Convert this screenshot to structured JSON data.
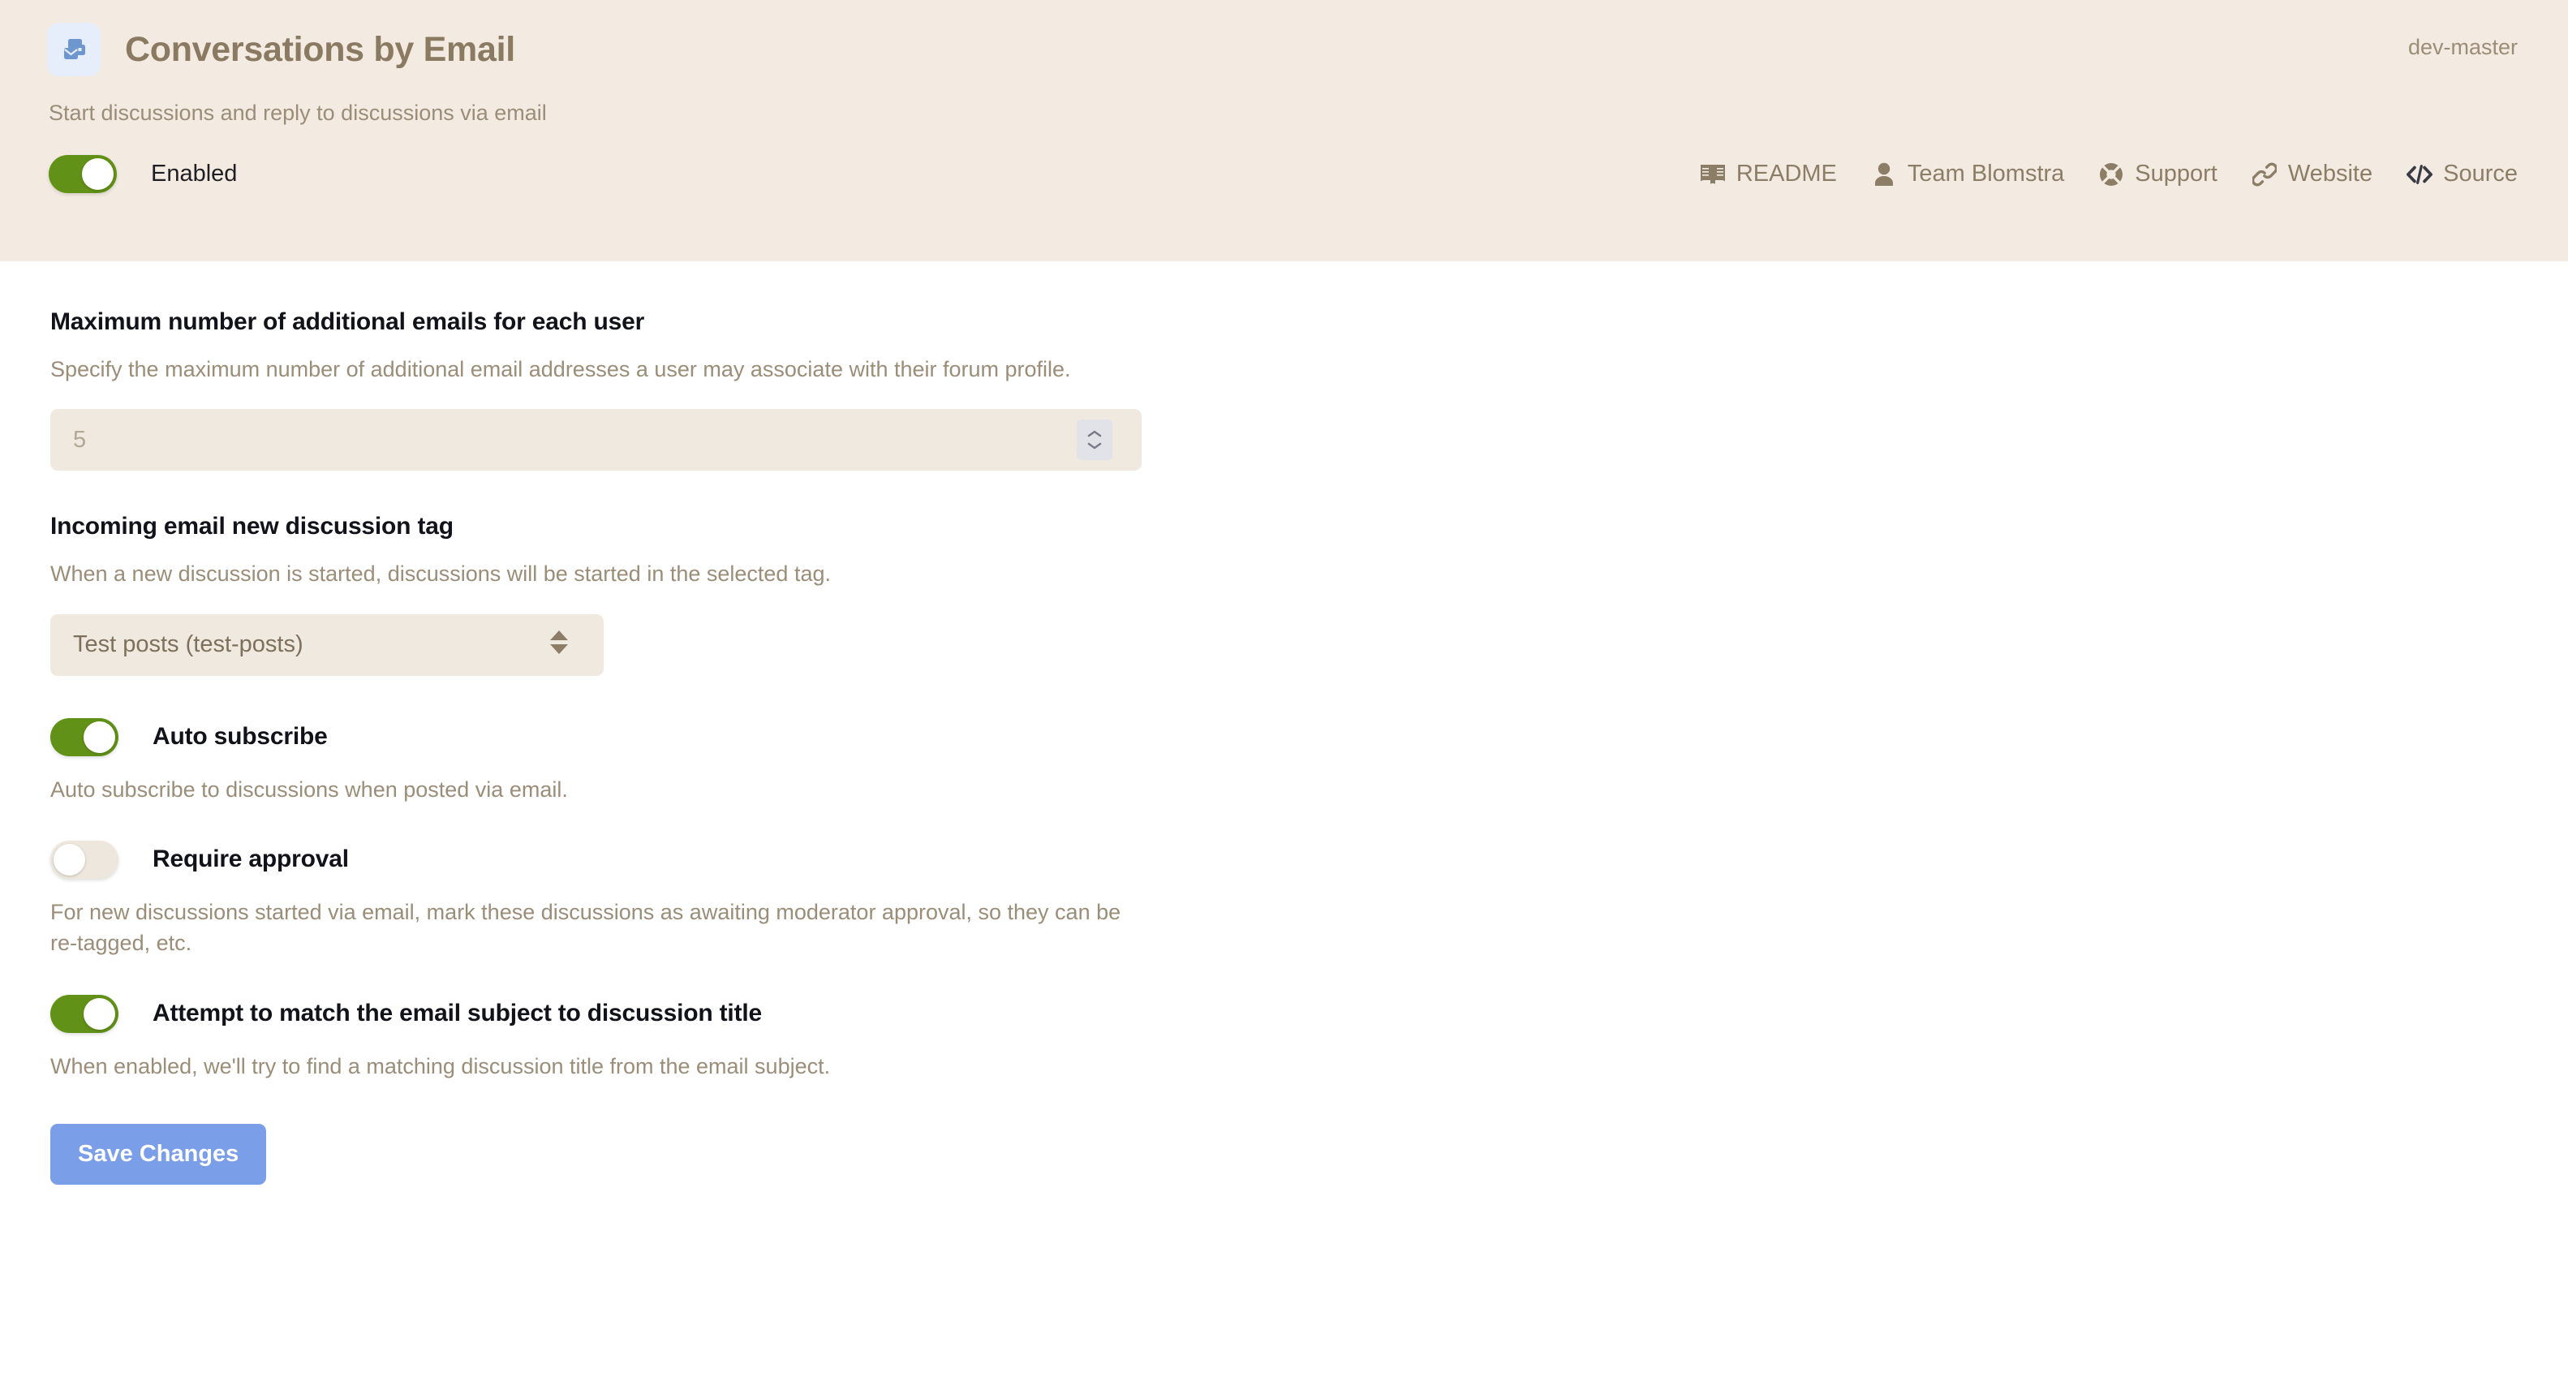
{
  "header": {
    "icon": "conversations-email-icon",
    "title": "Conversations by Email",
    "version": "dev-master",
    "description": "Start discussions and reply to discussions via email",
    "enabled_label": "Enabled",
    "enabled_state": true,
    "links": [
      {
        "label": "README",
        "icon": "book-icon"
      },
      {
        "label": "Team Blomstra",
        "icon": "user-icon"
      },
      {
        "label": "Support",
        "icon": "life-ring-icon"
      },
      {
        "label": "Website",
        "icon": "link-icon"
      },
      {
        "label": "Source",
        "icon": "code-icon"
      }
    ]
  },
  "settings": {
    "max_emails": {
      "title": "Maximum number of additional emails for each user",
      "help": "Specify the maximum number of additional email addresses a user may associate with their forum profile.",
      "value": "",
      "placeholder": "5"
    },
    "discussion_tag": {
      "title": "Incoming email new discussion tag",
      "help": "When a new discussion is started, discussions will be started in the selected tag.",
      "selected": "Test posts (test-posts)"
    },
    "auto_subscribe": {
      "label": "Auto subscribe",
      "help": "Auto subscribe to discussions when posted via email.",
      "state": true
    },
    "require_approval": {
      "label": "Require approval",
      "help": "For new discussions started via email, mark these discussions as awaiting moderator approval, so they can be re-tagged, etc.",
      "state": false
    },
    "match_subject": {
      "label": "Attempt to match the email subject to discussion title",
      "help": "When enabled, we'll try to find a matching discussion title from the email subject.",
      "state": true
    }
  },
  "footer": {
    "save_label": "Save Changes"
  },
  "colors": {
    "header_bg": "#f3ebe1",
    "toggle_on": "#629117",
    "toggle_off": "#eee7dd",
    "accent_button": "#7b9ee8",
    "title_text": "#8a7a62",
    "muted_text": "#9b8d78"
  }
}
